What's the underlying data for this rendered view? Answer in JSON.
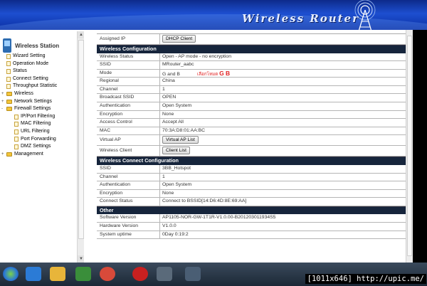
{
  "banner": {
    "title": "Wireless Router"
  },
  "sidebar": {
    "title": "Wireless Station",
    "items": [
      {
        "label": "Wizard Setting",
        "kind": "page",
        "level": 0
      },
      {
        "label": "Operation Mode",
        "kind": "page",
        "level": 0
      },
      {
        "label": "Status",
        "kind": "page",
        "level": 0
      },
      {
        "label": "Connect Setting",
        "kind": "page",
        "level": 0
      },
      {
        "label": "Throughput Statistic",
        "kind": "page",
        "level": 0
      },
      {
        "label": "Wireless",
        "kind": "folder",
        "level": 0,
        "expander": "+"
      },
      {
        "label": "Network Settings",
        "kind": "folder",
        "level": 0,
        "expander": "+"
      },
      {
        "label": "Firewall Settings",
        "kind": "folder",
        "level": 0,
        "expander": "-"
      },
      {
        "label": "IP/Port Filtering",
        "kind": "page",
        "level": 1
      },
      {
        "label": "MAC Filtering",
        "kind": "page",
        "level": 1
      },
      {
        "label": "URL Filtering",
        "kind": "page",
        "level": 1
      },
      {
        "label": "Port Forwarding",
        "kind": "page",
        "level": 1
      },
      {
        "label": "DMZ Settings",
        "kind": "page",
        "level": 1
      },
      {
        "label": "Management",
        "kind": "folder",
        "level": 0,
        "expander": "+"
      }
    ]
  },
  "top": {
    "assigned_ip_label": "Assigned IP",
    "dhcp_button": "DHCP Client"
  },
  "wireless_config": {
    "title": "Wireless Configuration",
    "rows": [
      {
        "k": "Wireless Status",
        "v": "Open - AP mode - no encryption"
      },
      {
        "k": "SSID",
        "v": "MRouter_aabc"
      },
      {
        "k": "Mode",
        "v": "G and B"
      },
      {
        "k": "Regional",
        "v": "China"
      },
      {
        "k": "Channel",
        "v": "1"
      },
      {
        "k": "Broadcast SSID",
        "v": "OPEN"
      },
      {
        "k": "Authentication",
        "v": "Open System"
      },
      {
        "k": "Encryption",
        "v": "None"
      },
      {
        "k": "Access Control",
        "v": "Accept All"
      },
      {
        "k": "MAC",
        "v": "70:3A:D8:01:AA:BC"
      }
    ],
    "mode_note_prefix": "เลือกโหมด",
    "mode_note_bold": "G B",
    "virtual_ap_label": "Virtual AP",
    "virtual_ap_button": "Virtual AP List",
    "wireless_client_label": "Wireless Client",
    "client_list_button": "Client List"
  },
  "connect_config": {
    "title": "Wireless Connect Configuration",
    "rows": [
      {
        "k": "SSID",
        "v": "3BB_Hotspot"
      },
      {
        "k": "Channel",
        "v": "1"
      },
      {
        "k": "Authentication",
        "v": "Open System"
      },
      {
        "k": "Encryption",
        "v": "None"
      },
      {
        "k": "Connect Status",
        "v": "Connect to  BSSID[14:D6:4D:8E:69:AA]"
      }
    ]
  },
  "other": {
    "title": "Other",
    "rows": [
      {
        "k": "Software Version",
        "v": "AP1105-NOR-GW-1T1R-V1.0.00-B201203011934S5"
      },
      {
        "k": "Hardware Version",
        "v": "V1.0.0"
      },
      {
        "k": "System uptime",
        "v": "0Day 0:19:2"
      }
    ]
  },
  "watermark": "[1011x646] http://upic.me/",
  "taskbar_icons": [
    "windows-start-icon",
    "ie-icon",
    "explorer-icon",
    "media-icon",
    "chrome-icon",
    "terminal-icon",
    "opera-icon",
    "app-icon",
    "app-icon-2"
  ]
}
